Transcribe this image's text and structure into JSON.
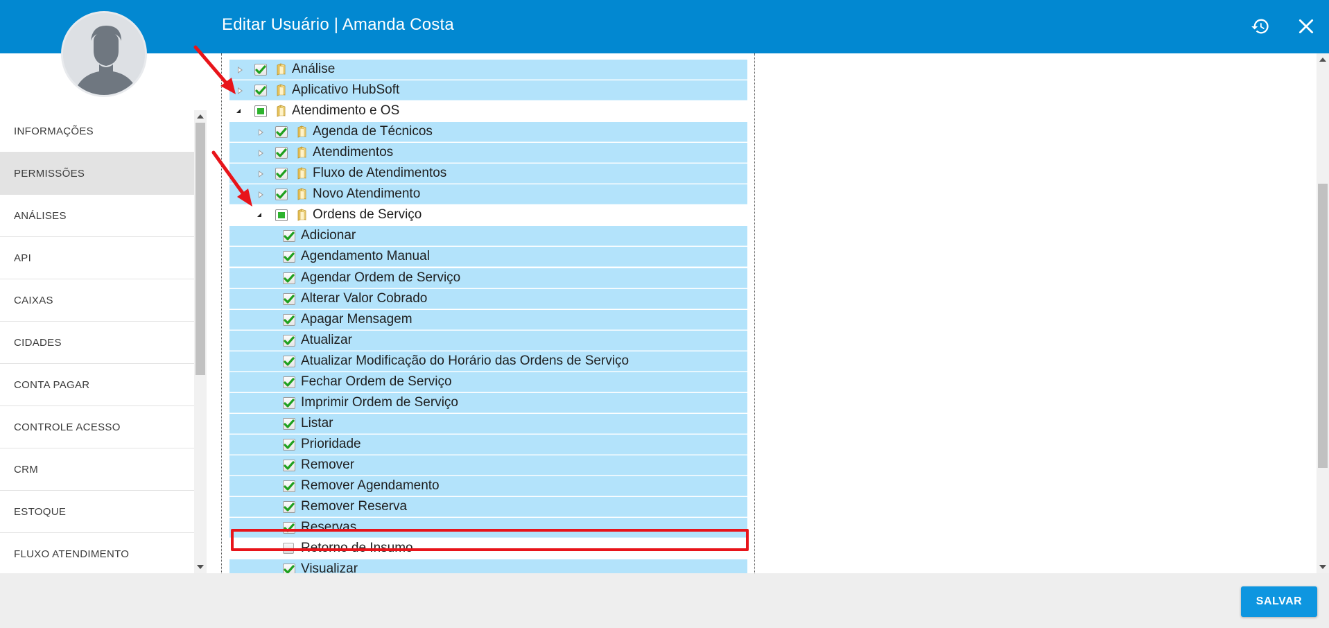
{
  "header": {
    "title": "Editar Usuário | Amanda Costa",
    "history_icon": "history-icon",
    "close_icon": "close-icon"
  },
  "sidebar": {
    "items": [
      {
        "label": "INFORMAÇÕES",
        "active": false
      },
      {
        "label": "PERMISSÕES",
        "active": true
      },
      {
        "label": "ANÁLISES",
        "active": false
      },
      {
        "label": "API",
        "active": false
      },
      {
        "label": "CAIXAS",
        "active": false
      },
      {
        "label": "CIDADES",
        "active": false
      },
      {
        "label": "CONTA PAGAR",
        "active": false
      },
      {
        "label": "CONTROLE ACESSO",
        "active": false
      },
      {
        "label": "CRM",
        "active": false
      },
      {
        "label": "ESTOQUE",
        "active": false
      },
      {
        "label": "FLUXO ATENDIMENTO",
        "active": false
      }
    ]
  },
  "tree": {
    "nodes": [
      {
        "label": "Análise",
        "level": 0,
        "expander": "collapsed",
        "check": "checked",
        "folder": true
      },
      {
        "label": "Aplicativo HubSoft",
        "level": 0,
        "expander": "collapsed",
        "check": "checked",
        "folder": true
      },
      {
        "label": "Atendimento e OS",
        "level": 0,
        "expander": "expanded",
        "check": "partial",
        "folder": true,
        "plain": true
      },
      {
        "label": "Agenda de Técnicos",
        "level": 1,
        "expander": "collapsed",
        "check": "checked",
        "folder": true
      },
      {
        "label": "Atendimentos",
        "level": 1,
        "expander": "collapsed",
        "check": "checked",
        "folder": true
      },
      {
        "label": "Fluxo de Atendimentos",
        "level": 1,
        "expander": "collapsed",
        "check": "checked",
        "folder": true
      },
      {
        "label": "Novo Atendimento",
        "level": 1,
        "expander": "collapsed",
        "check": "checked",
        "folder": true
      },
      {
        "label": "Ordens de Serviço",
        "level": 1,
        "expander": "expanded",
        "check": "partial",
        "folder": true,
        "plain": true
      },
      {
        "label": "Adicionar",
        "level": 2,
        "check": "checked"
      },
      {
        "label": "Agendamento Manual",
        "level": 2,
        "check": "checked"
      },
      {
        "label": "Agendar Ordem de Serviço",
        "level": 2,
        "check": "checked"
      },
      {
        "label": "Alterar Valor Cobrado",
        "level": 2,
        "check": "checked"
      },
      {
        "label": "Apagar Mensagem",
        "level": 2,
        "check": "checked"
      },
      {
        "label": "Atualizar",
        "level": 2,
        "check": "checked"
      },
      {
        "label": "Atualizar Modificação do Horário das Ordens de Serviço",
        "level": 2,
        "check": "checked"
      },
      {
        "label": "Fechar Ordem de Serviço",
        "level": 2,
        "check": "checked"
      },
      {
        "label": "Imprimir Ordem de Serviço",
        "level": 2,
        "check": "checked"
      },
      {
        "label": "Listar",
        "level": 2,
        "check": "checked"
      },
      {
        "label": "Prioridade",
        "level": 2,
        "check": "checked"
      },
      {
        "label": "Remover",
        "level": 2,
        "check": "checked"
      },
      {
        "label": "Remover Agendamento",
        "level": 2,
        "check": "checked"
      },
      {
        "label": "Remover Reserva",
        "level": 2,
        "check": "checked"
      },
      {
        "label": "Reservas",
        "level": 2,
        "check": "checked"
      },
      {
        "label": "Retorno de Insumo",
        "level": 2,
        "check": "empty",
        "plain": true,
        "highlighted": true
      },
      {
        "label": "Visualizar",
        "level": 2,
        "check": "checked"
      }
    ]
  },
  "footer": {
    "save_label": "SALVAR"
  },
  "colors": {
    "header": "#0288d1",
    "row_selected": "#b3e3fb",
    "highlight": "#e8141a",
    "save_button": "#0e96e0",
    "arrow": "#e8141a"
  }
}
